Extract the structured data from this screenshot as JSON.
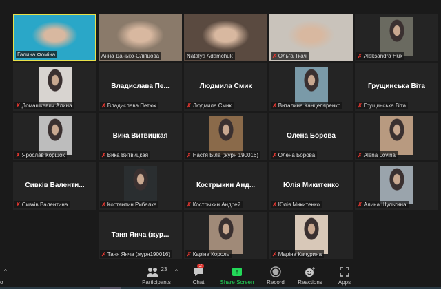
{
  "tiles": [
    {
      "name": "Галина Фоміна",
      "kind": "video",
      "bg": "#2aa7c8",
      "muted": false,
      "active": true
    },
    {
      "name": "Анна Данько-Сліпцова",
      "kind": "video",
      "bg": "#8a7a6a",
      "muted": false
    },
    {
      "name": "Natalya Adamchuk",
      "kind": "video",
      "bg": "#5a4a40",
      "muted": false
    },
    {
      "name": "Ольга Ткач",
      "kind": "video",
      "bg": "#c9c3bb",
      "muted": true
    },
    {
      "name": "Aleksandra Huk",
      "kind": "photo",
      "bg": "#6a6a60",
      "muted": true
    },
    {
      "name": "Домашкевич Алина",
      "kind": "photo",
      "bg": "#d8d4d0",
      "muted": true
    },
    {
      "name": "Владислава Петюх",
      "display": "Владислава  Пе...",
      "kind": "name",
      "muted": true
    },
    {
      "name": "Людмила Смик",
      "display": "Людмила Смик",
      "kind": "name",
      "muted": true
    },
    {
      "name": "Виталина Канцеляренко",
      "kind": "photo",
      "bg": "#7a9aa8",
      "muted": true
    },
    {
      "name": "Грущинська Віта",
      "display": "Грущинська Віта",
      "kind": "name",
      "muted": true
    },
    {
      "name": "Ярослав Коршок",
      "kind": "photo",
      "bg": "#bdbdbd",
      "muted": true
    },
    {
      "name": "Вика Витвицкая",
      "display": "Вика Витвицкая",
      "kind": "name",
      "muted": true
    },
    {
      "name": "Настя Біла (журн 190016)",
      "kind": "photo",
      "bg": "#8a6a4a",
      "muted": true
    },
    {
      "name": "Олена Борова",
      "display": "Олена Борова",
      "kind": "name",
      "muted": true
    },
    {
      "name": "Alena Lovina",
      "kind": "photo",
      "bg": "#b89a80",
      "muted": true
    },
    {
      "name": "Сивків Валентина",
      "display": "Сивків  Валенти...",
      "kind": "name",
      "muted": true
    },
    {
      "name": "Костянтин Рибалка",
      "kind": "photo",
      "bg": "#2a2e30",
      "muted": true
    },
    {
      "name": "Кострыкин Андрей",
      "display": "Кострыкин  Анд...",
      "kind": "name",
      "muted": true
    },
    {
      "name": "Юлія Микитенко",
      "display": "Юлія Микитенко",
      "kind": "name",
      "muted": true
    },
    {
      "name": "Алина Шульгина",
      "kind": "photo",
      "bg": "#9aa4ac",
      "muted": true
    },
    {
      "name": "Таня Янча (журн190016)",
      "display": "Таня Янча (жур...",
      "kind": "name",
      "muted": true
    },
    {
      "name": "Каріна Король",
      "kind": "photo",
      "bg": "#a08a78",
      "muted": true
    },
    {
      "name": "Маріна Качурина",
      "kind": "photo",
      "bg": "#d8c8b8",
      "muted": true
    }
  ],
  "toolbar": {
    "participants_label": "Participants",
    "participants_count": "23",
    "chat_label": "Chat",
    "chat_badge": "2",
    "share_label": "Share Screen",
    "share_color": "#23d959",
    "record_label": "Record",
    "reactions_label": "Reactions",
    "apps_label": "Apps",
    "video_label_partial": "o"
  }
}
